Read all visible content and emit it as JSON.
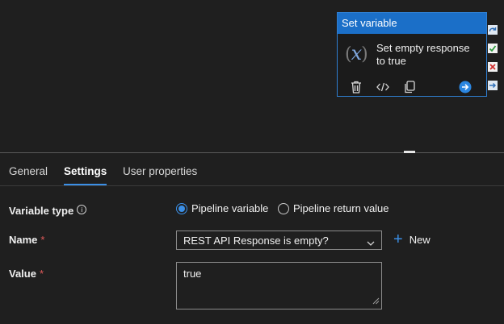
{
  "activity": {
    "title": "Set variable",
    "icon": "variable-icon",
    "icon_text": "x",
    "description": "Set empty response to true",
    "actions": [
      "delete-icon",
      "code-icon",
      "copy-icon",
      "go-arrow-icon"
    ],
    "side_icons": [
      "redo-icon",
      "success-check-icon",
      "failure-x-icon",
      "completion-arrow-icon"
    ]
  },
  "tabs": [
    {
      "label": "General",
      "active": false
    },
    {
      "label": "Settings",
      "active": true
    },
    {
      "label": "User properties",
      "active": false
    }
  ],
  "form": {
    "variable_type": {
      "label": "Variable type",
      "info_icon": "info-icon",
      "options": [
        "Pipeline variable",
        "Pipeline return value"
      ],
      "selected": "Pipeline variable"
    },
    "name": {
      "label": "Name",
      "required_mark": "*",
      "value": "REST API Response is empty?",
      "new_label": "New"
    },
    "value": {
      "label": "Value",
      "required_mark": "*",
      "value": "true"
    }
  },
  "colors": {
    "accent": "#3b8fe6",
    "header": "#1b6fc8",
    "background": "#1f1f1f",
    "required": "#e05a5a"
  }
}
